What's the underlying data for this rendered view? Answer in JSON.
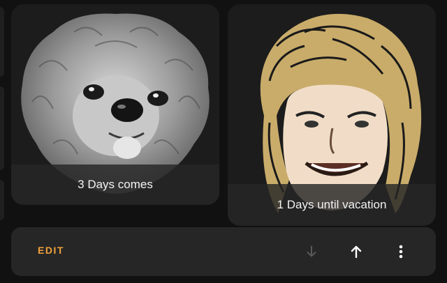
{
  "cards": [
    {
      "caption": "3 Days comes",
      "image": "dog-portrait-image"
    },
    {
      "caption": "1 Days until vacation",
      "image": "boy-portrait-image"
    }
  ],
  "toolbar": {
    "edit_label": "EDIT",
    "icons": [
      "arrow-down-icon",
      "arrow-up-icon",
      "more-vert-icon"
    ]
  },
  "colors": {
    "accent": "#F2A13B",
    "background": "#111111",
    "card": "#1C1C1C",
    "toolbar": "#262626",
    "disabled_icon": "#5A5A5A",
    "icon": "#FFFFFF"
  }
}
